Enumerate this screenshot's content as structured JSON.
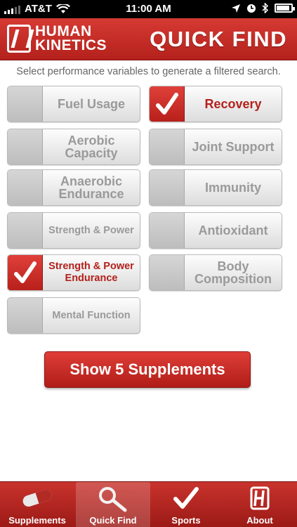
{
  "status": {
    "carrier": "AT&T",
    "time": "11:00 AM"
  },
  "header": {
    "brand_line1": "HUMAN",
    "brand_line2": "KINETICS",
    "title": "QUICK FIND"
  },
  "instruction": "Select performance variables to generate a filtered search.",
  "options": [
    {
      "label": "Fuel Usage",
      "checked": false
    },
    {
      "label": "Recovery",
      "checked": true
    },
    {
      "label": "Aerobic Capacity",
      "checked": false
    },
    {
      "label": "Joint Support",
      "checked": false
    },
    {
      "label": "Anaerobic Endurance",
      "checked": false
    },
    {
      "label": "Immunity",
      "checked": false
    },
    {
      "label": "Strength & Power",
      "checked": false
    },
    {
      "label": "Antioxidant",
      "checked": false
    },
    {
      "label": "Strength & Power Endurance",
      "checked": true
    },
    {
      "label": "Body Composition",
      "checked": false
    },
    {
      "label": "Mental Function",
      "checked": false
    }
  ],
  "cta": {
    "label": "Show 5 Supplements"
  },
  "tabs": [
    {
      "label": "Supplements",
      "icon": "pill-icon"
    },
    {
      "label": "Quick Find",
      "icon": "magnifier-icon",
      "active": true
    },
    {
      "label": "Sports",
      "icon": "checkmark-icon"
    },
    {
      "label": "About",
      "icon": "brand-logo-icon"
    }
  ],
  "colors": {
    "accent": "#c62a24",
    "inactive_text": "#9a9a9a"
  }
}
